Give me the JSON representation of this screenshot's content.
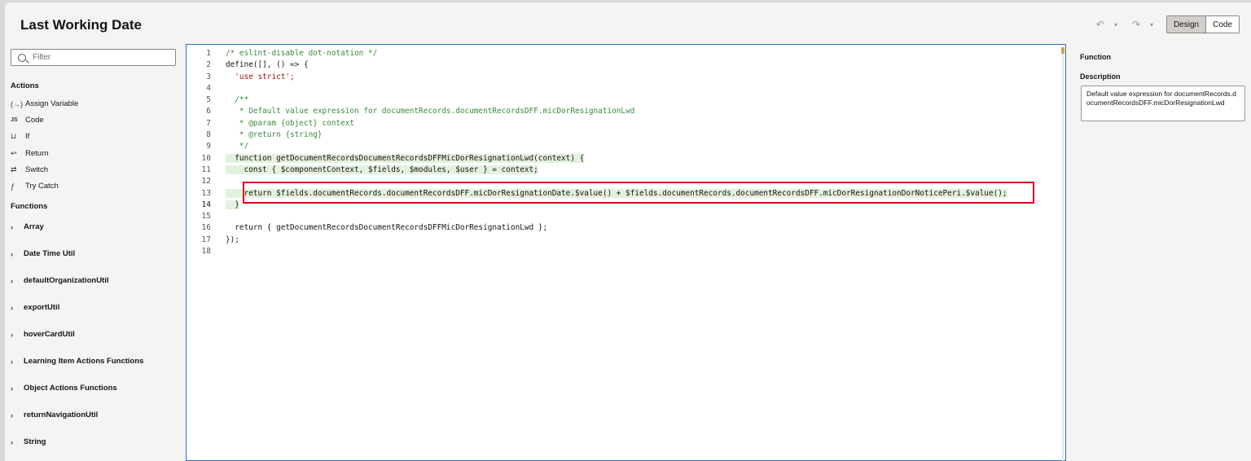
{
  "title": "Last Working Date",
  "toolbar": {
    "undo": "↶",
    "redo": "↷",
    "design_label": "Design",
    "code_label": "Code"
  },
  "left": {
    "filter_placeholder": "Filter",
    "actions_heading": "Actions",
    "actions": [
      {
        "icon": "(→)",
        "label": "Assign Variable"
      },
      {
        "icon": "JS",
        "label": "Code"
      },
      {
        "icon": "⊔",
        "label": "If"
      },
      {
        "icon": "↩",
        "label": "Return"
      },
      {
        "icon": "⇄",
        "label": "Switch"
      },
      {
        "icon": "ƒ",
        "label": "Try Catch"
      }
    ],
    "functions_heading": "Functions",
    "functions": [
      "Array",
      "Date Time Util",
      "defaultOrganizationUtil",
      "exportUtil",
      "hoverCardUtil",
      "Learning Item Actions Functions",
      "Object Actions Functions",
      "returnNavigationUtil",
      "String"
    ]
  },
  "editor": {
    "line_numbers": [
      "1",
      "2",
      "3",
      "4",
      "5",
      "6",
      "7",
      "8",
      "9",
      "10",
      "11",
      "12",
      "13",
      "14",
      "15",
      "16",
      "17",
      "18"
    ],
    "lines": [
      "/* eslint-disable dot-notation */",
      "define([], () => {",
      "  'use strict';",
      "",
      "  /**",
      "   * Default value expression for documentRecords.documentRecordsDFF.micDorResignationLwd",
      "   * @param {object} context",
      "   * @return {string}",
      "   */",
      "  function getDocumentRecordsDocumentRecordsDFFMicDorResignationLwd(context) {",
      "    const { $componentContext, $fields, $modules, $user } = context;",
      "",
      "    return $fields.documentRecords.documentRecordsDFF.micDorResignationDate.$value() + $fields.documentRecords.documentRecordsDFF.micDorResignationDorNoticePeri.$value();",
      "  }",
      "",
      "  return { getDocumentRecordsDocumentRecordsDFFMicDorResignationLwd };",
      "});",
      ""
    ]
  },
  "right": {
    "heading": "Function",
    "description_label": "Description",
    "description_value": "Default value expression for documentRecords.documentRecordsDFF.micDorResignationLwd"
  }
}
